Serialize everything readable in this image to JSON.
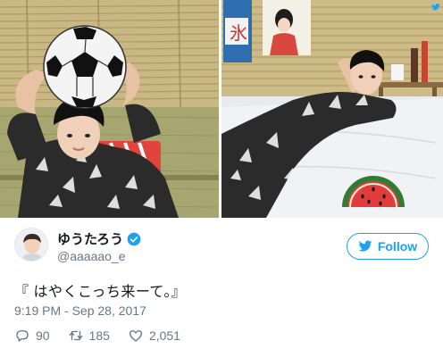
{
  "tweet": {
    "user": {
      "display_name": "ゆうたろう",
      "handle": "@aaaaao_e",
      "verified": true
    },
    "follow_label": "Follow",
    "text": "『 はやくこっち来ーて。』",
    "timestamp": "9:19 PM - Sep 28, 2017",
    "actions": {
      "replies": "90",
      "retweets": "185",
      "likes": "2,051"
    }
  },
  "photos": [
    {
      "icon": "photo-soccer-ball-icon"
    },
    {
      "icon": "photo-watermelon-icon"
    }
  ],
  "colors": {
    "accent": "#1da1f2",
    "text": "#14171a",
    "muted": "#657786"
  }
}
